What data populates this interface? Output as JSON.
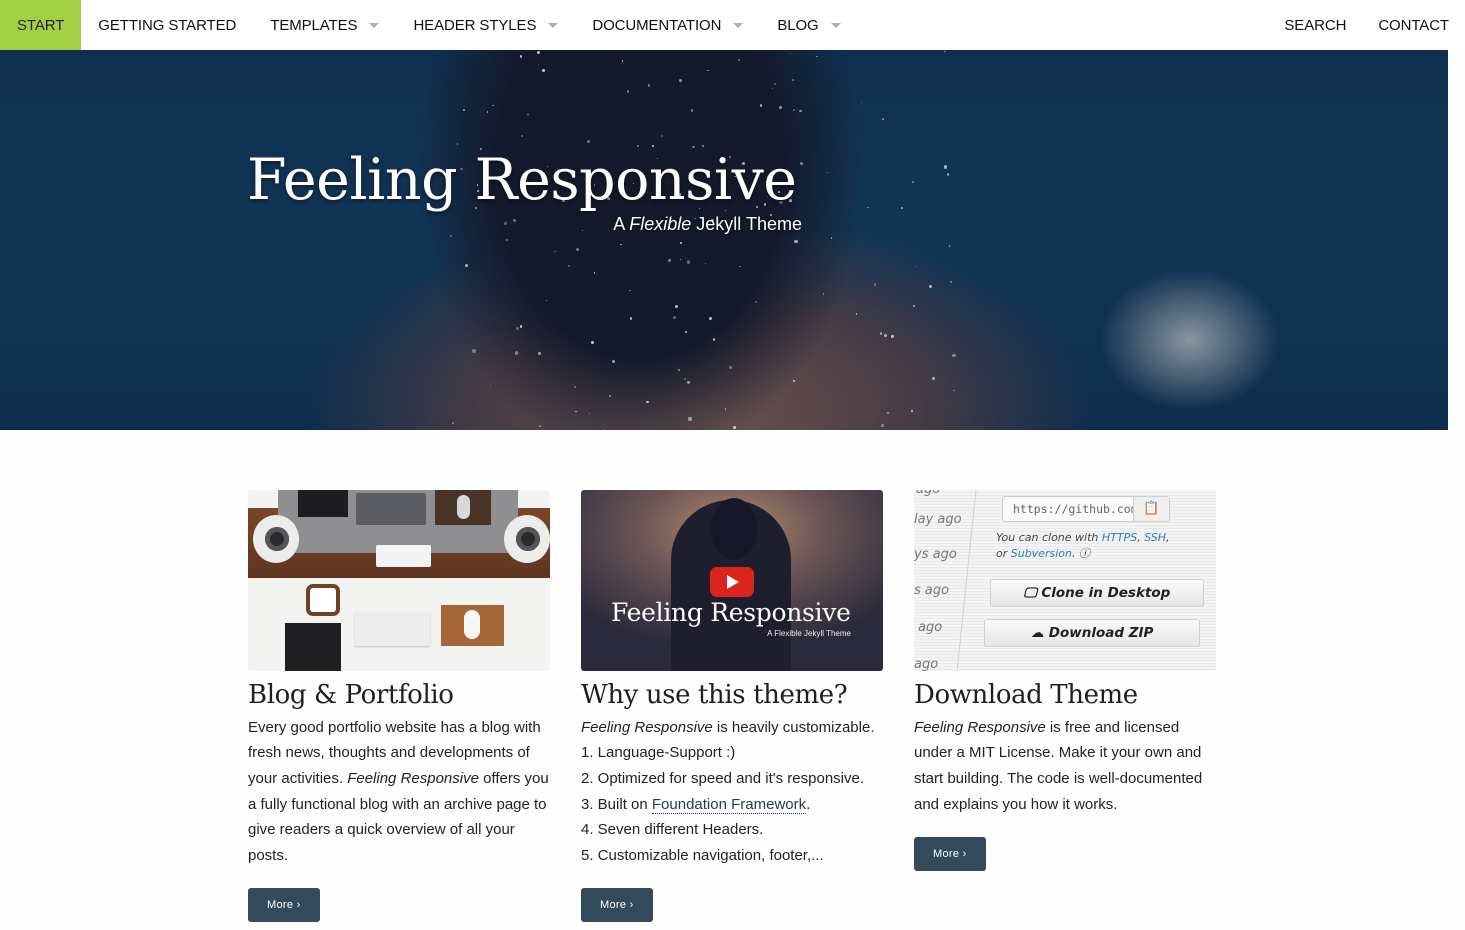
{
  "nav": {
    "left": [
      {
        "label": "START",
        "active": true,
        "dropdown": false
      },
      {
        "label": "GETTING STARTED",
        "active": false,
        "dropdown": false
      },
      {
        "label": "TEMPLATES",
        "active": false,
        "dropdown": true
      },
      {
        "label": "HEADER STYLES",
        "active": false,
        "dropdown": true
      },
      {
        "label": "DOCUMENTATION",
        "active": false,
        "dropdown": true
      },
      {
        "label": "BLOG",
        "active": false,
        "dropdown": true
      }
    ],
    "right": [
      {
        "label": "SEARCH"
      },
      {
        "label": "CONTACT"
      }
    ],
    "active_color": "#a3cf45"
  },
  "hero": {
    "title": "Feeling Responsive",
    "subtitle_prefix": "A ",
    "subtitle_em": "Flexible",
    "subtitle_suffix": " Jekyll Theme"
  },
  "cards": [
    {
      "title": "Blog & Portfolio",
      "body_1": "Every good portfolio website has a blog with fresh news, thoughts and develop­ments of your activities. ",
      "body_em": "Feeling Responsive",
      "body_2": " offers you a fully functional blog with an ar­chive page to give readers a quick overview of all your posts.",
      "button": "More ›",
      "image": "desk-workspace-photo"
    },
    {
      "title": "Why use this theme?",
      "intro_em": "Feeling Responsive",
      "intro_rest": " is heavily customizable.",
      "list": [
        "1. Language-Support :)",
        "2. Optimized for speed and it's responsive.",
        "3. Built on ",
        "4. Seven different Headers.",
        "5. Customizable navigation, footer,..."
      ],
      "link_text": "Foundation Framework",
      "link_after": ".",
      "button": "More ›",
      "image": "video-thumbnail",
      "video_title": "Feeling Responsive",
      "video_subtitle": "A Flexible Jekyll Theme"
    },
    {
      "title": "Download Theme",
      "body_em": "Feeling Responsive",
      "body_rest": " is free and licensed under a MIT License. Make it your own and start building. The code is well-documented and explains you how it works.",
      "button": "More ›",
      "image": "github-clone-screenshot",
      "git": {
        "url": "https://github.com",
        "note_1": "You can clone with ",
        "https": "HTTPS",
        "ssh": "SSH",
        "note_2": "or ",
        "svn": "Subversion",
        "clone_desktop": "Clone in Desktop",
        "download_zip": "Download ZIP",
        "ago": [
          "ago",
          "lay ago",
          "ys ago",
          "s ago",
          "ago",
          "ago"
        ]
      }
    }
  ],
  "colors": {
    "button_bg": "#334a5a",
    "accent": "#a3cf45"
  }
}
